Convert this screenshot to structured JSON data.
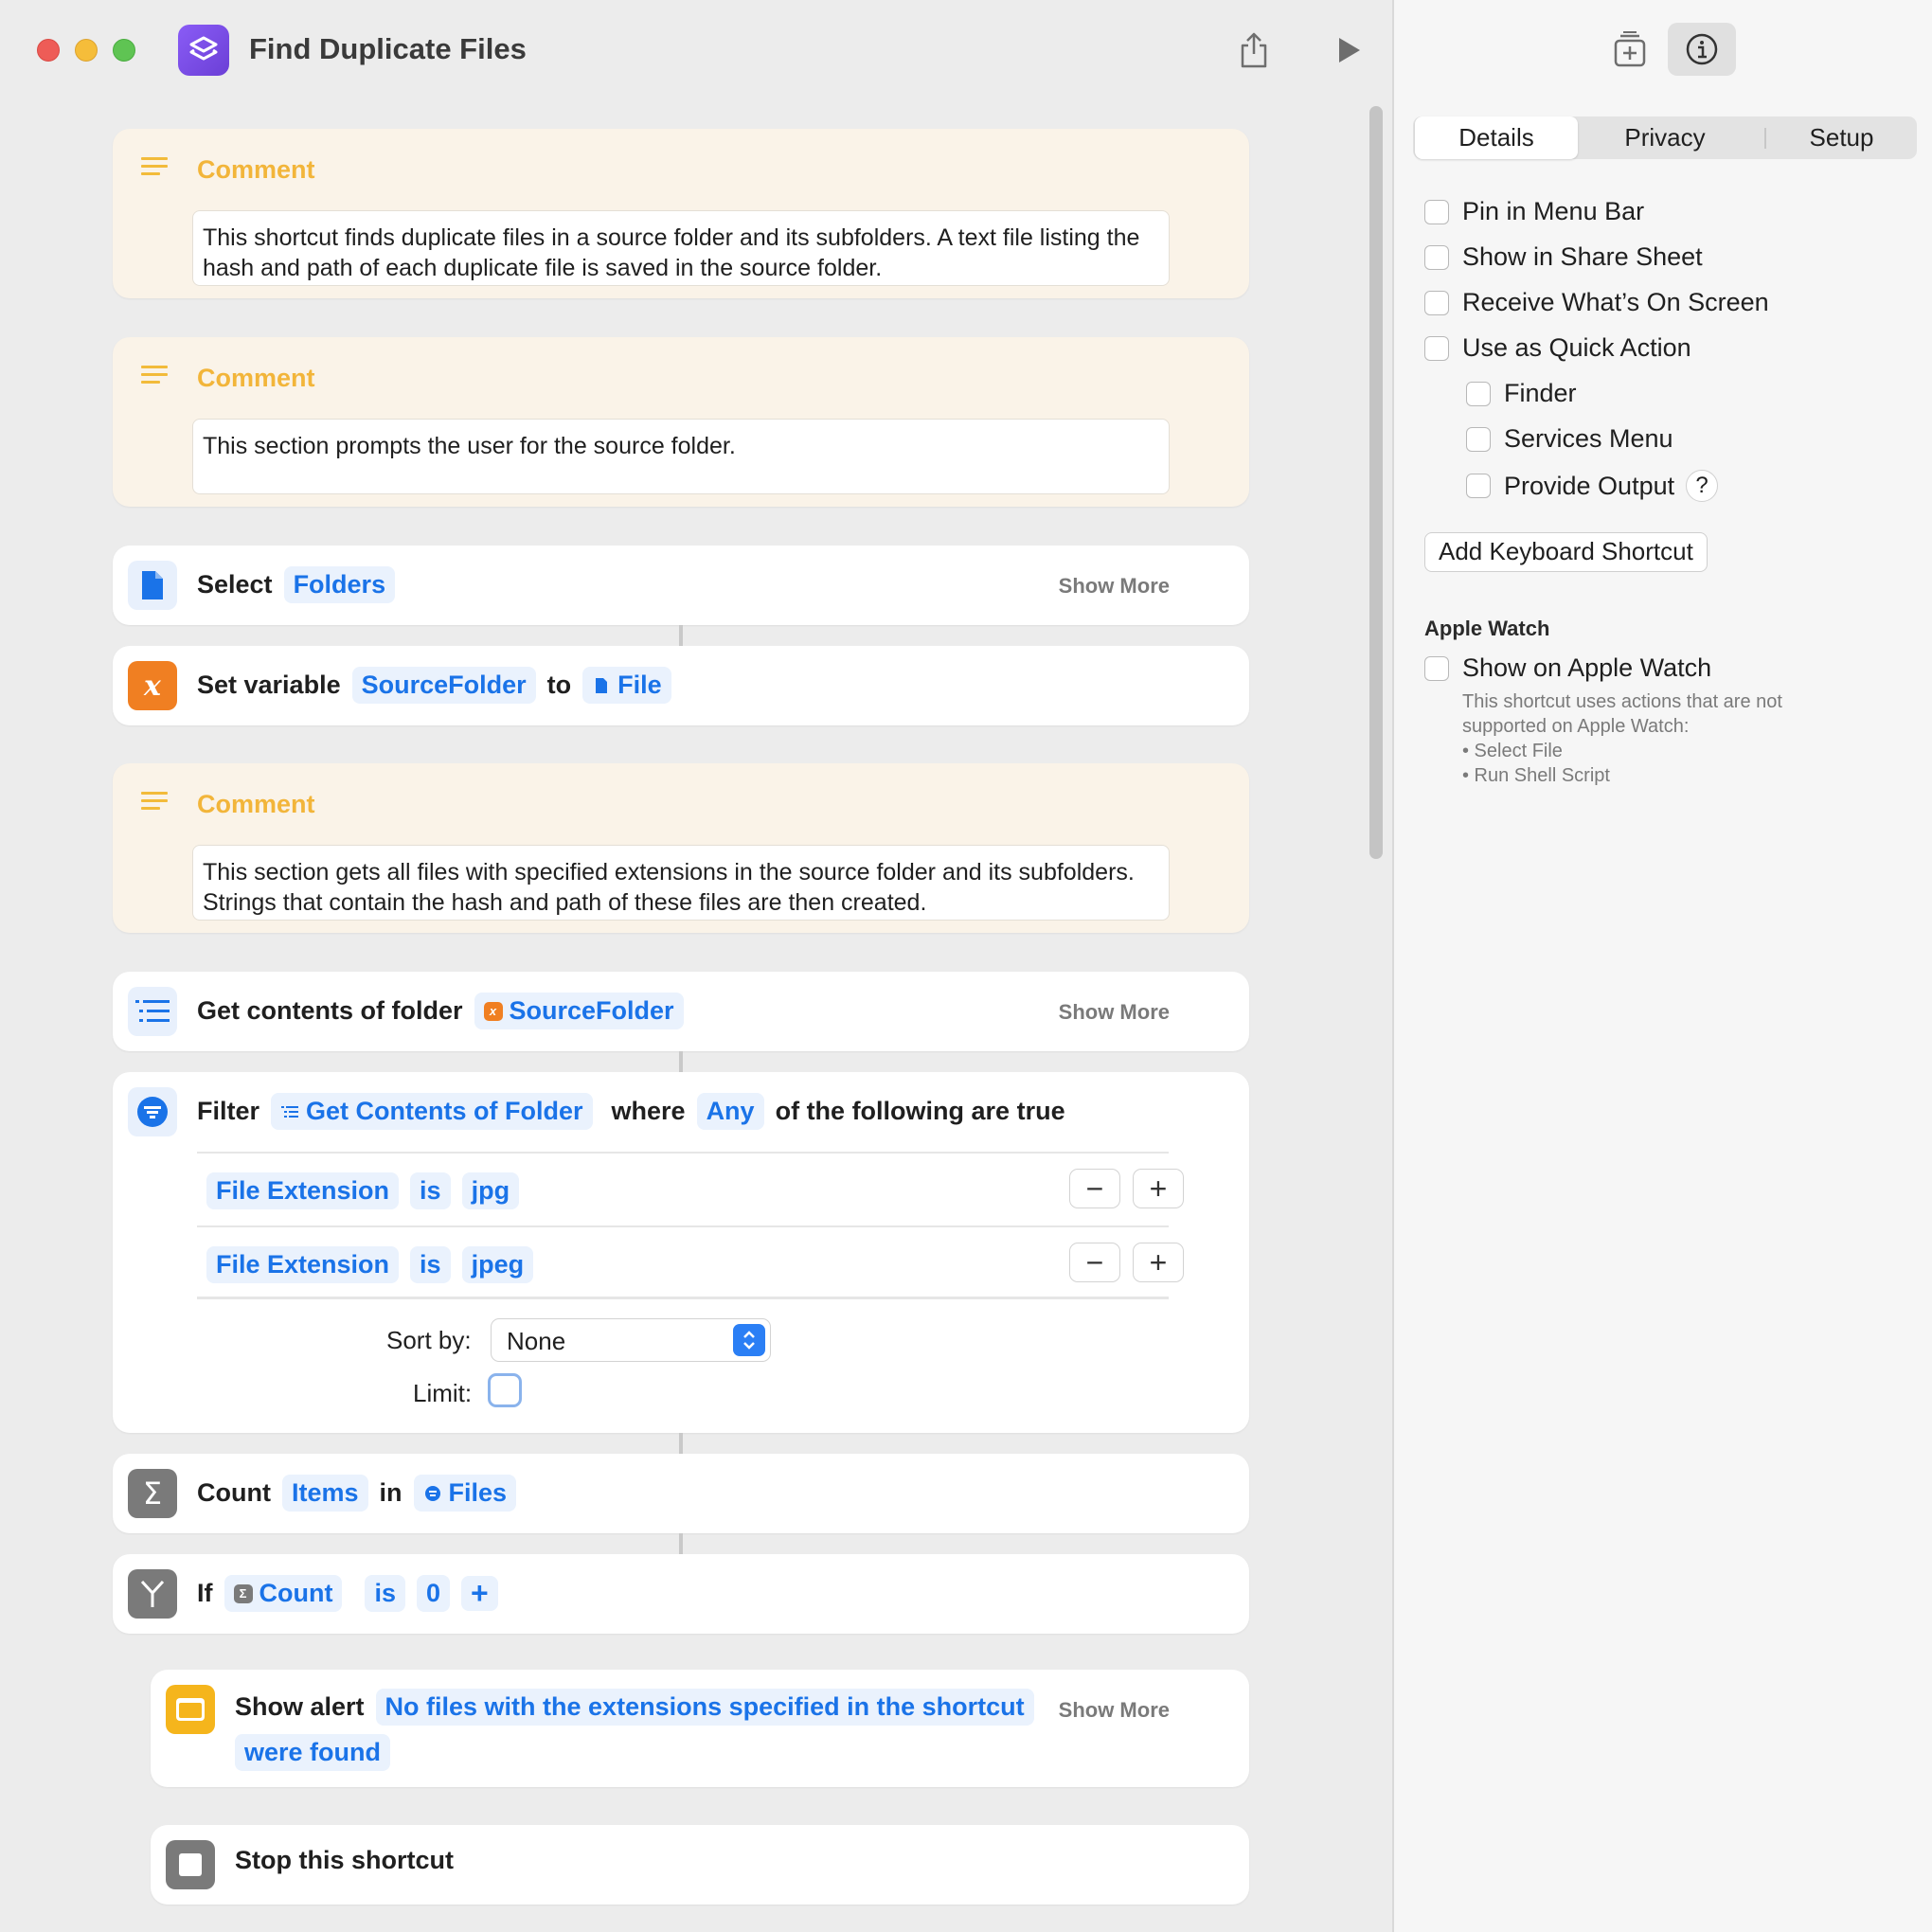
{
  "window": {
    "title": "Find Duplicate Files"
  },
  "actions": {
    "comment1": {
      "label": "Comment",
      "text": "This shortcut finds duplicate files in a source folder and its subfolders. A text file listing the hash and path of each duplicate file is saved in the source folder."
    },
    "comment2": {
      "label": "Comment",
      "text": "This section prompts the user for the source folder."
    },
    "select": {
      "verb": "Select",
      "token": "Folders",
      "show_more": "Show More"
    },
    "set_variable": {
      "verb": "Set variable",
      "variable": "SourceFolder",
      "to": "to",
      "value": "File"
    },
    "comment3": {
      "label": "Comment",
      "text": "This section gets all files with specified extensions in the source folder and its subfolders. Strings that contain the hash and path of these files are then created."
    },
    "get_contents": {
      "verb": "Get contents of folder",
      "token": "SourceFolder",
      "show_more": "Show More"
    },
    "filter": {
      "verb": "Filter",
      "input": "Get Contents of Folder",
      "where": "where",
      "mode": "Any",
      "suffix": "of the following are true",
      "conditions": [
        {
          "property": "File Extension",
          "op": "is",
          "value": "jpg",
          "minus": "−",
          "plus": "+"
        },
        {
          "property": "File Extension",
          "op": "is",
          "value": "jpeg",
          "minus": "−",
          "plus": "+"
        }
      ],
      "sort_label": "Sort by:",
      "sort_value": "None",
      "limit_label": "Limit:"
    },
    "count": {
      "verb": "Count",
      "token": "Items",
      "in": "in",
      "input": "Files"
    },
    "if": {
      "verb": "If",
      "input": "Count",
      "op": "is",
      "value": "0",
      "add": "+"
    },
    "alert": {
      "verb": "Show alert",
      "text_line1": "No files with the extensions specified in the shortcut",
      "text_line2": "were found",
      "show_more": "Show More"
    },
    "stop": {
      "verb": "Stop this shortcut"
    }
  },
  "sidebar": {
    "tabs": [
      "Details",
      "Privacy",
      "Setup"
    ],
    "options": {
      "pin": "Pin in Menu Bar",
      "share": "Show in Share Sheet",
      "receive": "Receive What’s On Screen",
      "quick_action": "Use as Quick Action",
      "finder": "Finder",
      "services": "Services Menu",
      "provide_output": "Provide Output",
      "help": "?"
    },
    "keyboard_button": "Add Keyboard Shortcut",
    "watch": {
      "heading": "Apple Watch",
      "option": "Show on Apple Watch",
      "note1": "This shortcut uses actions that are not",
      "note2": "supported on Apple Watch:",
      "item1": "• Select File",
      "item2": "• Run Shell Script"
    }
  },
  "colors": {
    "accent": "#1a73e8",
    "comment_bg": "#faf3e8",
    "comment_label": "#f2b53a",
    "variable_orange": "#f07f22",
    "alert_yellow": "#f5b51c"
  }
}
